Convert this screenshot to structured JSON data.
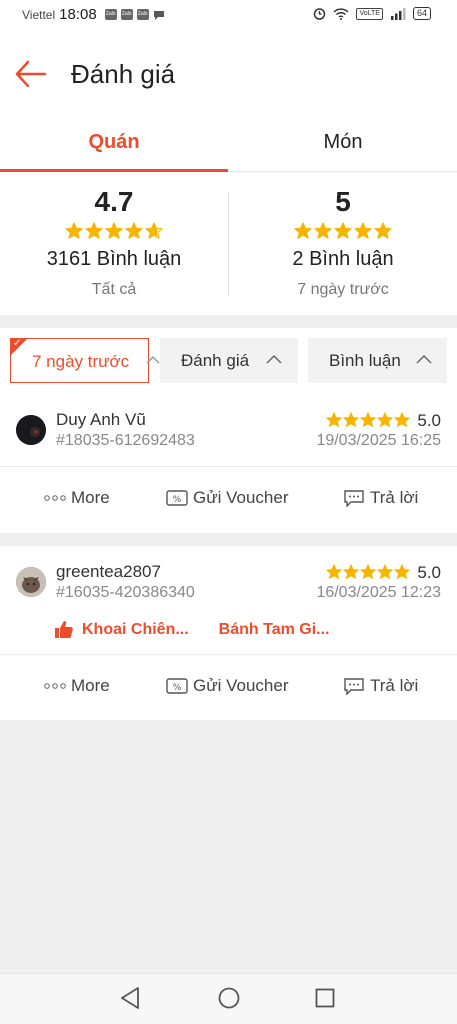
{
  "status_bar": {
    "carrier": "Viettel",
    "time": "18:08",
    "notif_icons": [
      "Zalo",
      "Zalo",
      "Zalo"
    ],
    "volte": "VoLTE",
    "battery": "64"
  },
  "header": {
    "title": "Đánh giá"
  },
  "tabs": [
    {
      "label": "Quán",
      "active": true
    },
    {
      "label": "Món",
      "active": false
    }
  ],
  "summary": {
    "left": {
      "score": "4.7",
      "rating": 4.7,
      "count": "3161 Bình luận",
      "period": "Tất cả"
    },
    "right": {
      "score": "5",
      "rating": 5,
      "count": "2 Bình luận",
      "period": "7 ngày trước"
    }
  },
  "filters": [
    {
      "label": "7 ngày trước",
      "selected": true
    },
    {
      "label": "Đánh giá",
      "selected": false
    },
    {
      "label": "Bình luận",
      "selected": false
    }
  ],
  "reviews": [
    {
      "name": "Duy Anh Vũ",
      "order_id": "#18035-612692483",
      "score": "5.0",
      "rating": 5,
      "date": "19/03/2025 16:25",
      "liked": []
    },
    {
      "name": "greentea2807",
      "order_id": "#16035-420386340",
      "score": "5.0",
      "rating": 5,
      "date": "16/03/2025 12:23",
      "liked": [
        "Khoai Chiên...",
        "Bánh Tam Gi..."
      ]
    }
  ],
  "actions": {
    "more": "More",
    "voucher": "Gửi Voucher",
    "reply": "Trả lời"
  },
  "colors": {
    "accent": "#ee4d2d",
    "star": "#f7b500"
  }
}
